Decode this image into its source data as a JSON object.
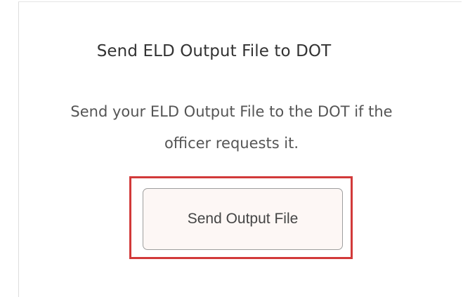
{
  "section": {
    "title": "Send ELD Output File to DOT",
    "description_line1": "Send your ELD Output File to the DOT if the",
    "description_line2": "officer requests it.",
    "button_label": "Send Output File"
  },
  "colors": {
    "highlight": "#d23a3a",
    "button_background": "#fdf7f5",
    "button_border": "#9e9e9e"
  }
}
